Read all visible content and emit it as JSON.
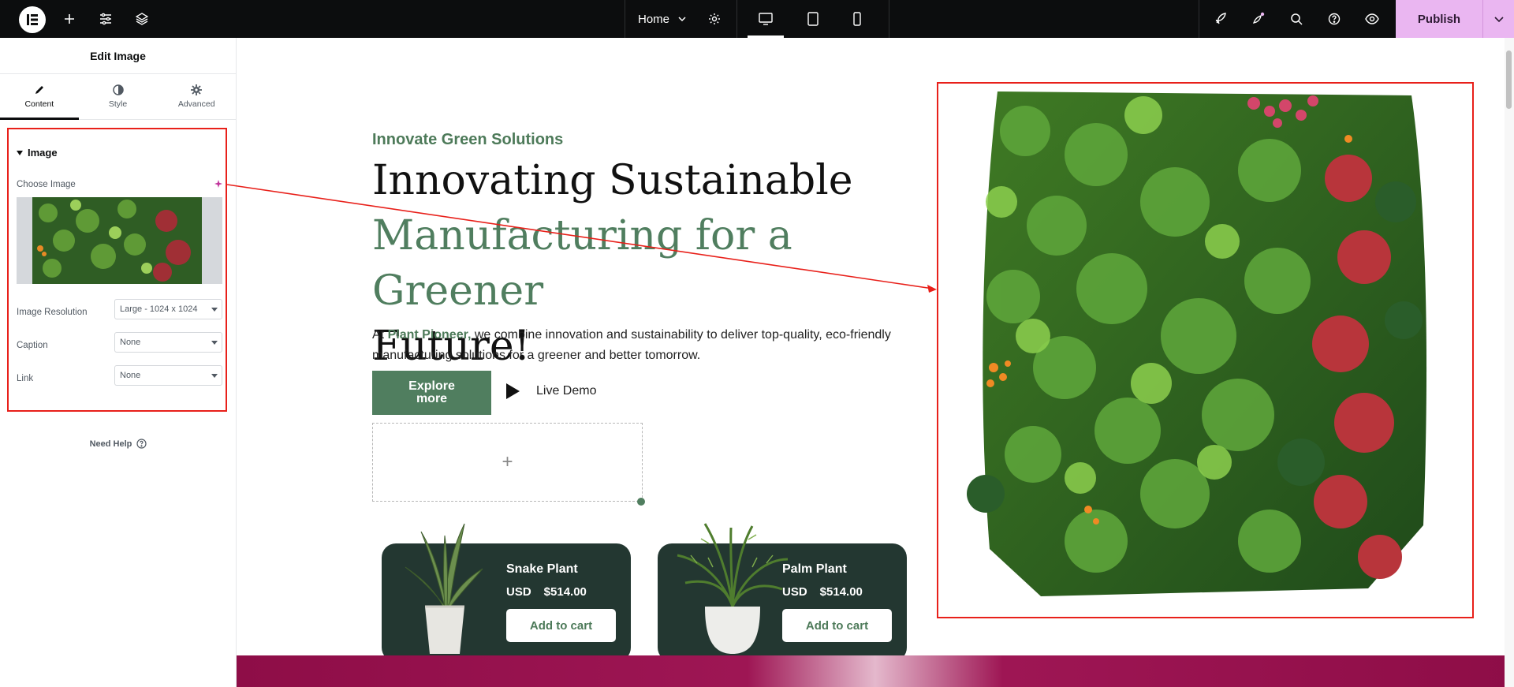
{
  "topbar": {
    "page_name": "Home",
    "publish_label": "Publish"
  },
  "panel": {
    "title": "Edit Image",
    "tabs": [
      {
        "label": "Content",
        "icon": "pencil-icon",
        "active": true
      },
      {
        "label": "Style",
        "icon": "contrast-icon",
        "active": false
      },
      {
        "label": "Advanced",
        "icon": "gear-icon",
        "active": false
      }
    ],
    "section_title": "Image",
    "choose_image_label": "Choose Image",
    "image_resolution_label": "Image Resolution",
    "image_resolution_value": "Large - 1024 x 1024",
    "caption_label": "Caption",
    "caption_value": "None",
    "link_label": "Link",
    "link_value": "None",
    "need_help": "Need Help"
  },
  "canvas": {
    "eyebrow": "Innovate Green Solutions",
    "headline_line1": "Innovating Sustainable",
    "headline_line2": "Manufacturing for a Greener",
    "headline_line3": "Future!",
    "intro_prefix": "At",
    "intro_brand": "Plant Pioneer,",
    "intro_rest": "we combine innovation and sustainability to deliver top-quality, eco-friendly manufacturing solutions for a greener and better tomorrow.",
    "explore_label": "Explore more",
    "live_demo_label": "Live Demo",
    "dropzone_plus": "+",
    "products": [
      {
        "name": "Snake Plant",
        "currency": "USD",
        "price": "$514.00",
        "cta": "Add to cart"
      },
      {
        "name": "Palm Plant",
        "currency": "USD",
        "price": "$514.00",
        "cta": "Add to cart"
      }
    ]
  },
  "colors": {
    "brand_green": "#507e5f",
    "card_dark": "#233731",
    "publish_bg": "#eab6f1",
    "highlight_red": "#e8201a"
  }
}
